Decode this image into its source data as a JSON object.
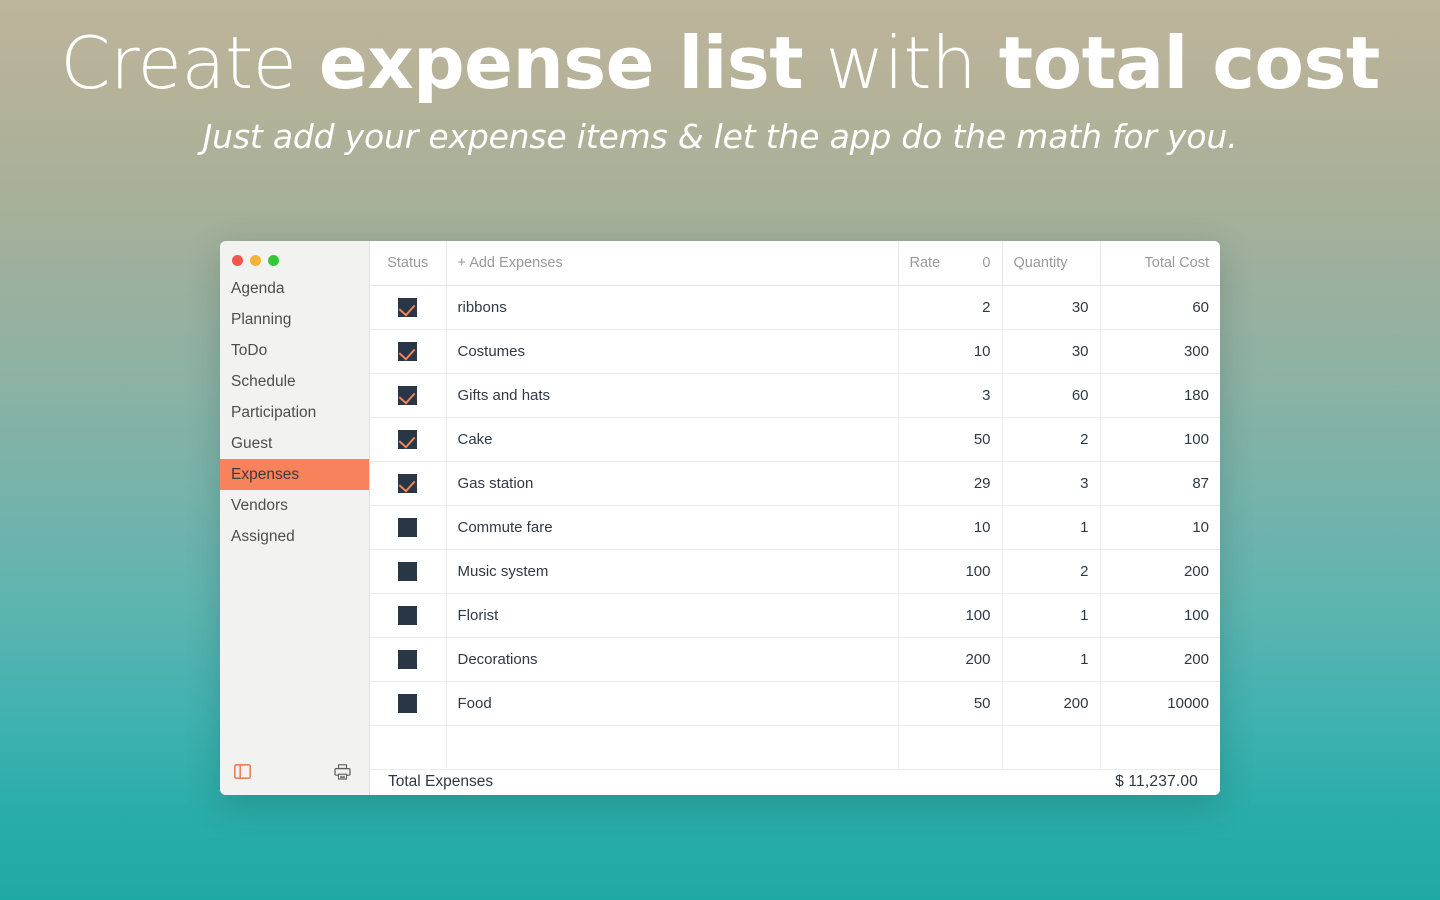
{
  "hero": {
    "title_part1": "Create ",
    "title_part2": "expense list",
    "title_part3": " with ",
    "title_part4": "total cost",
    "subtitle": "Just add your expense items & let the app do the math for you."
  },
  "colors": {
    "accent_orange": "#f7825b",
    "checkbox_navy": "#283645",
    "check_orange": "#f0835c",
    "bg_top": "#bdb49b",
    "bg_bottom": "#1fa9a5",
    "sidebar_bg": "#f2f2f0"
  },
  "window": {
    "traffic_lights": [
      {
        "name": "close",
        "color": "#f2564f"
      },
      {
        "name": "minimize",
        "color": "#f6b333"
      },
      {
        "name": "zoom",
        "color": "#36c83c"
      }
    ]
  },
  "sidebar": {
    "items": [
      {
        "label": "Agenda",
        "active": false
      },
      {
        "label": "Planning",
        "active": false
      },
      {
        "label": "ToDo",
        "active": false
      },
      {
        "label": "Schedule",
        "active": false
      },
      {
        "label": "Participation",
        "active": false
      },
      {
        "label": "Guest",
        "active": false
      },
      {
        "label": "Expenses",
        "active": true
      },
      {
        "label": "Vendors",
        "active": false
      },
      {
        "label": "Assigned",
        "active": false
      }
    ],
    "footer": {
      "toggle_icon": "sidebar-toggle-icon",
      "print_icon": "printer-icon"
    }
  },
  "table": {
    "headers": {
      "status": "Status",
      "name": "+ Add Expenses",
      "rate": "Rate",
      "rate_sum": "0",
      "quantity": "Quantity",
      "total": "Total Cost"
    },
    "rows": [
      {
        "checked": true,
        "name": "ribbons",
        "rate": "2",
        "quantity": "30",
        "total": "60"
      },
      {
        "checked": true,
        "name": "Costumes",
        "rate": "10",
        "quantity": "30",
        "total": "300"
      },
      {
        "checked": true,
        "name": "Gifts and hats",
        "rate": "3",
        "quantity": "60",
        "total": "180"
      },
      {
        "checked": true,
        "name": "Cake",
        "rate": "50",
        "quantity": "2",
        "total": "100"
      },
      {
        "checked": true,
        "name": "Gas station",
        "rate": "29",
        "quantity": "3",
        "total": "87"
      },
      {
        "checked": false,
        "name": "Commute fare",
        "rate": "10",
        "quantity": "1",
        "total": "10"
      },
      {
        "checked": false,
        "name": "Music system",
        "rate": "100",
        "quantity": "2",
        "total": "200"
      },
      {
        "checked": false,
        "name": "Florist",
        "rate": "100",
        "quantity": "1",
        "total": "100"
      },
      {
        "checked": false,
        "name": "Decorations",
        "rate": "200",
        "quantity": "1",
        "total": "200"
      },
      {
        "checked": false,
        "name": "Food",
        "rate": "50",
        "quantity": "200",
        "total": "10000"
      }
    ]
  },
  "totals": {
    "label": "Total Expenses",
    "amount": "$ 11,237.00"
  }
}
